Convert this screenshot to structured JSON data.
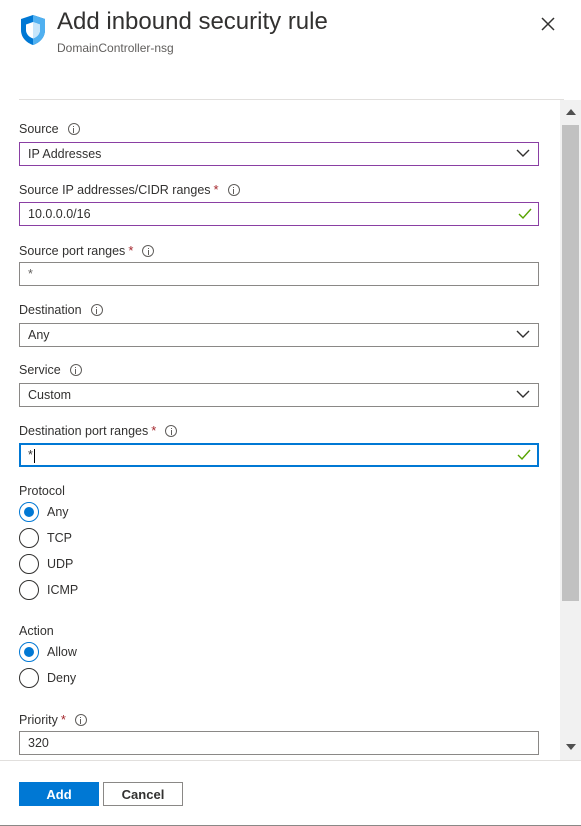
{
  "header": {
    "title": "Add inbound security rule",
    "subtitle": "DomainController-nsg",
    "shield_icon": "shield-icon",
    "close_icon": "close-icon"
  },
  "form": {
    "source": {
      "label": "Source",
      "required": false,
      "value": "IP Addresses",
      "type": "dropdown"
    },
    "source_ip": {
      "label": "Source IP addresses/CIDR ranges",
      "required_mark": "*",
      "value": "10.0.0.0/16",
      "valid": true
    },
    "source_port": {
      "label": "Source port ranges",
      "required_mark": "*",
      "placeholder": "*"
    },
    "destination": {
      "label": "Destination",
      "value": "Any",
      "type": "dropdown"
    },
    "service": {
      "label": "Service",
      "value": "Custom",
      "type": "dropdown"
    },
    "destination_port": {
      "label": "Destination port ranges",
      "required_mark": "*",
      "value": "*",
      "valid": true,
      "focused": true
    },
    "protocol": {
      "label": "Protocol",
      "options": [
        "Any",
        "TCP",
        "UDP",
        "ICMP"
      ],
      "selected": "Any"
    },
    "action": {
      "label": "Action",
      "options": [
        "Allow",
        "Deny"
      ],
      "selected": "Allow"
    },
    "priority": {
      "label": "Priority",
      "required_mark": "*",
      "value": "320"
    }
  },
  "footer": {
    "add_label": "Add",
    "cancel_label": "Cancel"
  },
  "colors": {
    "accent": "#0078d4",
    "required": "#a4262c",
    "valid_check": "#57a300",
    "dropdown_border": "#8a3fa3"
  }
}
